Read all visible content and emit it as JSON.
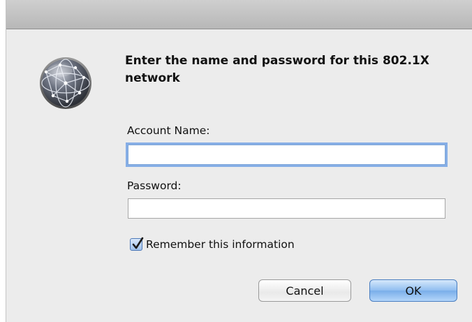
{
  "dialog": {
    "heading": "Enter the name and password for this 802.1X network",
    "account_label": "Account Name:",
    "account_value": "",
    "password_label": "Password:",
    "password_value": "",
    "remember_label": "Remember this information",
    "remember_checked": true,
    "cancel_label": "Cancel",
    "ok_label": "OK",
    "icon": "network-globe-icon"
  },
  "colors": {
    "focus_ring": "#86aee6",
    "default_button": "#8fbdf0",
    "background": "#ececec"
  }
}
